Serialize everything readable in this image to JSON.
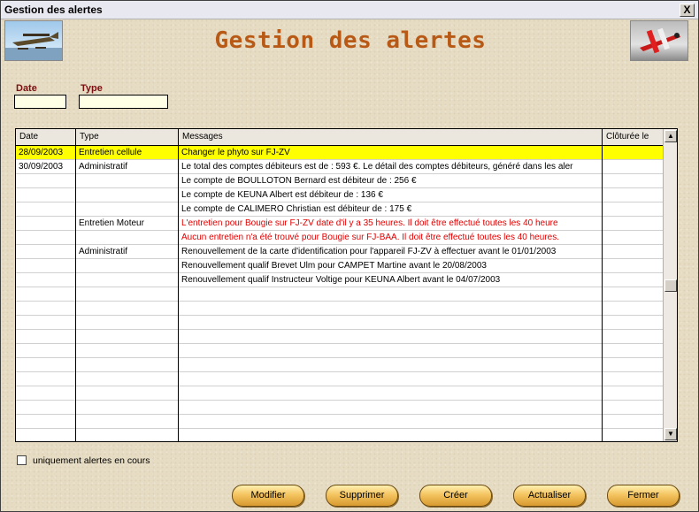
{
  "window": {
    "title": "Gestion des alertes",
    "close_label": "X"
  },
  "heading": "Gestion des alertes",
  "filters": {
    "date_label": "Date",
    "date_value": "",
    "type_label": "Type",
    "type_value": ""
  },
  "table": {
    "columns": [
      "Date",
      "Type",
      "Messages",
      "Clôturée le"
    ],
    "rows": [
      {
        "date": "28/09/2003",
        "type": "Entretien cellule",
        "message": "Changer le phyto sur FJ-ZV",
        "closed": "",
        "selected": true
      },
      {
        "date": "30/09/2003",
        "type": "Administratif",
        "message": "Le total des comptes débiteurs est de : 593 €. Le détail des comptes débiteurs, généré dans les aler",
        "closed": ""
      },
      {
        "date": "",
        "type": "",
        "message": "Le compte de BOULLOTON Bernard est débiteur de :  256 €",
        "closed": ""
      },
      {
        "date": "",
        "type": "",
        "message": "Le compte de KEUNA Albert est débiteur de :  136 €",
        "closed": ""
      },
      {
        "date": "",
        "type": "",
        "message": "Le compte de CALIMERO Christian est débiteur de :  175 €",
        "closed": ""
      },
      {
        "date": "",
        "type": "Entretien Moteur",
        "message": "L'entretien pour Bougie sur FJ-ZV date d'il y a 35 heures. Il doit être effectué toutes les 40 heure",
        "closed": "",
        "red": true
      },
      {
        "date": "",
        "type": "",
        "message": "Aucun entretien n'a été trouvé pour Bougie sur FJ-BAA. Il doit être effectué toutes les 40 heures.",
        "closed": "",
        "red": true
      },
      {
        "date": "",
        "type": "Administratif",
        "message": "Renouvellement de la carte d'identification pour l'appareil FJ-ZV à effectuer avant le 01/01/2003",
        "closed": ""
      },
      {
        "date": "",
        "type": "",
        "message": "Renouvellement qualif Brevet Ulm pour CAMPET Martine avant le 20/08/2003",
        "closed": ""
      },
      {
        "date": "",
        "type": "",
        "message": "Renouvellement qualif Instructeur Voltige pour KEUNA Albert avant le 04/07/2003",
        "closed": ""
      }
    ],
    "empty_rows": 11
  },
  "checkbox": {
    "label": "uniquement alertes en cours",
    "checked": false
  },
  "buttons": {
    "modifier": "Modifier",
    "supprimer": "Supprimer",
    "creer": "Créer",
    "actualiser": "Actualiser",
    "fermer": "Fermer"
  },
  "colors": {
    "heading": "#b85a16",
    "selected_row": "#ffff00",
    "alert_text": "#e00000",
    "label": "#7a1010"
  },
  "icons": [
    "seaplane-logo",
    "biplane-logo",
    "close-icon",
    "scroll-up-icon",
    "scroll-down-icon"
  ]
}
